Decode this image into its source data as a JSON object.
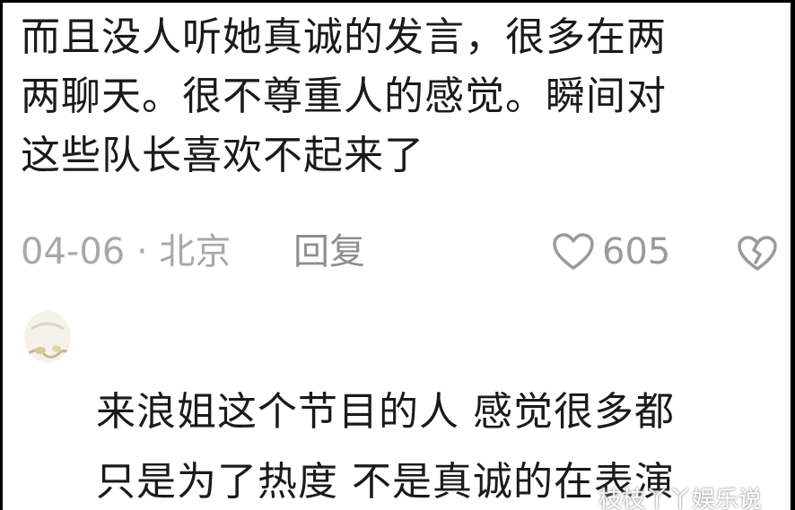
{
  "comment": {
    "lines": [
      "而且没人听她真诚的发言，很多在两",
      "两聊天。很不尊重人的感觉。瞬间对",
      "这些队长喜欢不起来了"
    ],
    "date_location": "04-06 · 北京",
    "reply_label": "回复",
    "like_count": "605",
    "like_icon": "heart-outline-icon",
    "dislike_icon": "broken-heart-icon"
  },
  "reply": {
    "avatar_icon": "avatar",
    "lines": [
      "来浪姐这个节目的人 感觉很多都",
      "只是为了热度 不是真诚的在表演"
    ]
  },
  "watermark": {
    "text": "枝枝丫丫娱乐说"
  },
  "colors": {
    "text": "#1a1a1a",
    "meta": "#a8a8a8",
    "border": "#000000",
    "background": "#ffffff"
  }
}
